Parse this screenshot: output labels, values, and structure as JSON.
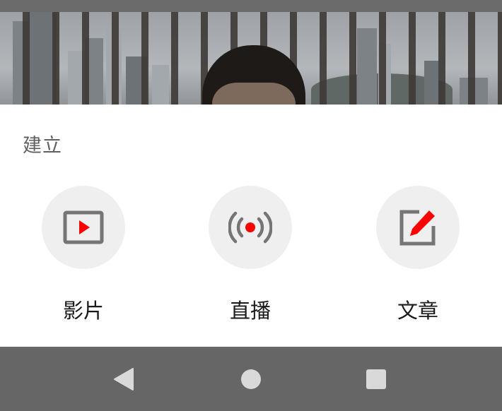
{
  "sheet": {
    "title": "建立",
    "options": [
      {
        "label": "影片",
        "icon": "video-upload-icon"
      },
      {
        "label": "直播",
        "icon": "live-broadcast-icon"
      },
      {
        "label": "文章",
        "icon": "edit-post-icon"
      }
    ]
  },
  "navbar": {
    "buttons": [
      "back-icon",
      "home-icon",
      "recents-icon"
    ]
  },
  "colors": {
    "accent": "#ff0000",
    "icon_gray": "#757575",
    "sheet_bg": "#ffffff",
    "icon_circle": "#efefef",
    "scrim": "#666666"
  }
}
